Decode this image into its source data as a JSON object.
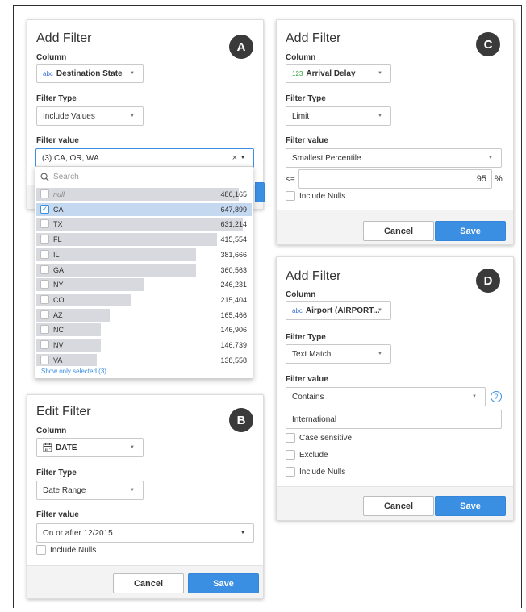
{
  "panel_a": {
    "badge": "A",
    "title": "Add Filter",
    "column_label": "Column",
    "column_type": "abc",
    "column_value": "Destination State",
    "filter_type_label": "Filter Type",
    "filter_type_value": "Include Values",
    "filter_value_label": "Filter value",
    "filter_value": "(3) CA, OR, WA",
    "clear_glyph": "×",
    "search_placeholder": "Search",
    "rows": [
      {
        "label": "null",
        "count": "486,165",
        "checked": false,
        "fill": 0.94
      },
      {
        "label": "CA",
        "count": "647,899",
        "checked": true,
        "fill": 1.0
      },
      {
        "label": "TX",
        "count": "631,214",
        "checked": false,
        "fill": 0.96
      },
      {
        "label": "FL",
        "count": "415,554",
        "checked": false,
        "fill": 0.84
      },
      {
        "label": "IL",
        "count": "381,666",
        "checked": false,
        "fill": 0.74
      },
      {
        "label": "GA",
        "count": "360,563",
        "checked": false,
        "fill": 0.74
      },
      {
        "label": "NY",
        "count": "246,231",
        "checked": false,
        "fill": 0.5
      },
      {
        "label": "CO",
        "count": "215,404",
        "checked": false,
        "fill": 0.44
      },
      {
        "label": "AZ",
        "count": "165,466",
        "checked": false,
        "fill": 0.34
      },
      {
        "label": "NC",
        "count": "146,906",
        "checked": false,
        "fill": 0.3
      },
      {
        "label": "NV",
        "count": "146,739",
        "checked": false,
        "fill": 0.3
      },
      {
        "label": "VA",
        "count": "138,558",
        "checked": false,
        "fill": 0.28
      }
    ],
    "show_selected": "Show only selected (3)"
  },
  "panel_b": {
    "badge": "B",
    "title": "Edit Filter",
    "column_label": "Column",
    "column_value": "DATE",
    "filter_type_label": "Filter Type",
    "filter_type_value": "Date Range",
    "filter_value_label": "Filter value",
    "filter_value": "On or after 12/2015",
    "include_nulls": "Include Nulls",
    "cancel": "Cancel",
    "save": "Save"
  },
  "panel_c": {
    "badge": "C",
    "title": "Add Filter",
    "column_label": "Column",
    "column_type": "123",
    "column_value": "Arrival Delay",
    "filter_type_label": "Filter Type",
    "filter_type_value": "Limit",
    "filter_value_label": "Filter value",
    "filter_value": "Smallest Percentile",
    "operator": "<=",
    "number": "95",
    "unit": "%",
    "include_nulls": "Include Nulls",
    "cancel": "Cancel",
    "save": "Save"
  },
  "panel_d": {
    "badge": "D",
    "title": "Add Filter",
    "column_label": "Column",
    "column_type": "abc",
    "column_value": "Airport (AIRPORT...",
    "filter_type_label": "Filter Type",
    "filter_type_value": "Text Match",
    "filter_value_label": "Filter value",
    "filter_value": "Contains",
    "text_input": "International",
    "case_sensitive": "Case sensitive",
    "exclude": "Exclude",
    "include_nulls": "Include Nulls",
    "cancel": "Cancel",
    "save": "Save"
  },
  "colors": {
    "accent": "#3b8fe3",
    "badge": "#3a3a3a",
    "type_number": "#2e9e3c",
    "type_text": "#3b6fd1"
  }
}
